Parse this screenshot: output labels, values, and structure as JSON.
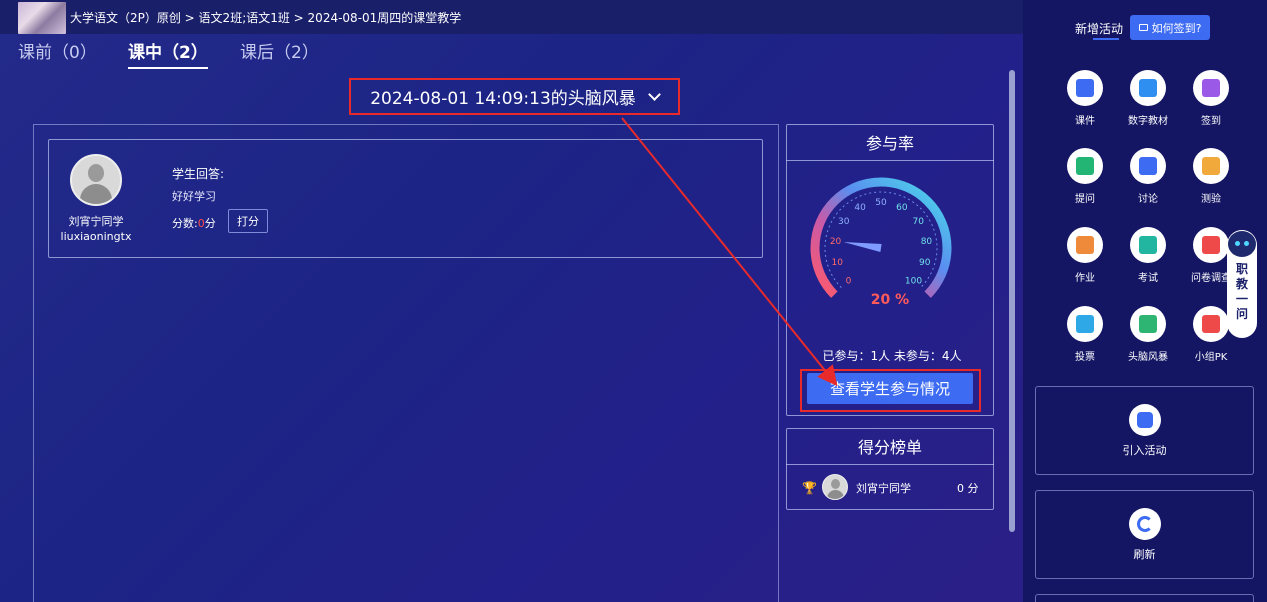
{
  "header": {
    "breadcrumb": "大学语文（2P）原创 > 语文2班;语文1班 > 2024-08-01周四的课堂教学"
  },
  "tabs": [
    {
      "label": "课前（0）",
      "active": false
    },
    {
      "label": "课中（2）",
      "active": true
    },
    {
      "label": "课后（2）",
      "active": false
    }
  ],
  "activity": {
    "title": "2024-08-01 14:09:13的头脑风暴"
  },
  "answer": {
    "student_name": "刘宵宁同学",
    "student_id": "liuxiaoningtx",
    "answer_label": "学生回答:",
    "answer_text": "好好学习",
    "score_label": "分数:",
    "score_value": "0",
    "score_unit": "分",
    "score_button": "打分"
  },
  "participation": {
    "title": "参与率",
    "percent_label": "20 %",
    "percent_value": 20,
    "gauge_ticks": [
      "0",
      "10",
      "20",
      "30",
      "40",
      "50",
      "60",
      "70",
      "80",
      "90",
      "100"
    ],
    "stats": "已参与：1人    未参与：4人",
    "view_button": "查看学生参与情况"
  },
  "ranking": {
    "title": "得分榜单",
    "rows": [
      {
        "name": "刘宵宁同学",
        "score": "0 分"
      }
    ]
  },
  "sidebar": {
    "tab_label": "新增活动",
    "help_button": "如何签到?",
    "tools": [
      {
        "label": "课件",
        "icon": "courseware-icon",
        "color": "#3d6bf2"
      },
      {
        "label": "数字教材",
        "icon": "digital-textbook-icon",
        "color": "#2f8ff0"
      },
      {
        "label": "签到",
        "icon": "signin-icon",
        "color": "#9b59e8"
      },
      {
        "label": "提问",
        "icon": "question-icon",
        "color": "#22b573"
      },
      {
        "label": "讨论",
        "icon": "discussion-icon",
        "color": "#3d6bf2"
      },
      {
        "label": "测验",
        "icon": "quiz-icon",
        "color": "#f2a93b"
      },
      {
        "label": "作业",
        "icon": "homework-icon",
        "color": "#f08a3b"
      },
      {
        "label": "考试",
        "icon": "exam-icon",
        "color": "#22b5a0"
      },
      {
        "label": "问卷调查",
        "icon": "survey-icon",
        "color": "#ef4a4a"
      },
      {
        "label": "投票",
        "icon": "vote-icon",
        "color": "#2fa8e8"
      },
      {
        "label": "头脑风暴",
        "icon": "brainstorm-icon",
        "color": "#2fb573"
      },
      {
        "label": "小组PK",
        "icon": "group-pk-icon",
        "color": "#ef4a4a"
      }
    ],
    "import_label": "引入活动",
    "refresh_label": "刷新"
  },
  "assistant": {
    "text": "职教一问"
  }
}
